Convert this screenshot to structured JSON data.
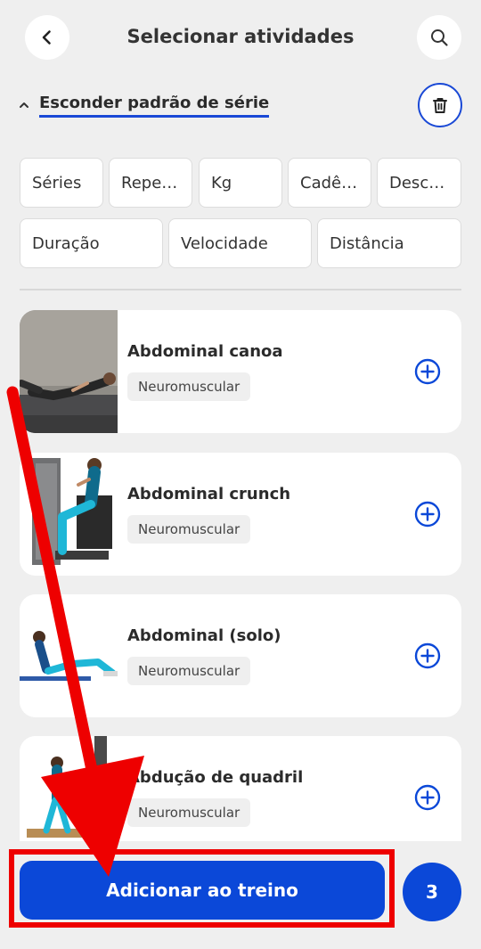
{
  "header": {
    "title": "Selecionar atividades",
    "back_icon": "chevron-left-icon",
    "search_icon": "search-icon"
  },
  "series_toggle": {
    "label": "Esconder padrão de série",
    "icon": "chevron-up-icon",
    "trash_icon": "trash-icon"
  },
  "fields": [
    "Séries",
    "Repe…",
    "Kg",
    "Cadê…",
    "Desc…",
    "Duração",
    "Velocidade",
    "Distância"
  ],
  "activities": [
    {
      "name": "Abdominal canoa",
      "category": "Neuromuscular"
    },
    {
      "name": "Abdominal crunch",
      "category": "Neuromuscular"
    },
    {
      "name": "Abdominal (solo)",
      "category": "Neuromuscular"
    },
    {
      "name": "Abdução de quadril",
      "category": "Neuromuscular"
    }
  ],
  "footer": {
    "add_label": "Adicionar ao treino",
    "count": "3"
  },
  "colors": {
    "primary": "#0b48d8",
    "annotation": "#ee0000",
    "background": "#efefef"
  }
}
